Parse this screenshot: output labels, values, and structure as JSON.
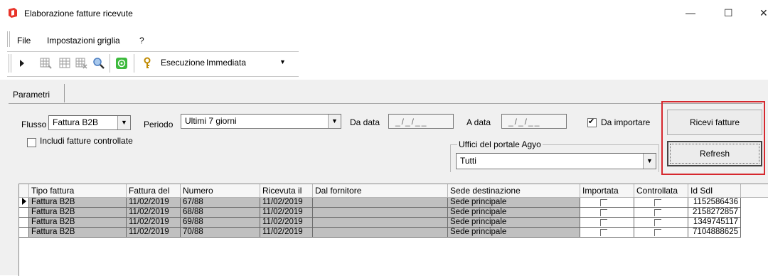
{
  "window": {
    "title": "Elaborazione fatture ricevute",
    "minimize_glyph": "—",
    "maximize_glyph": "☐",
    "close_glyph": "✕"
  },
  "menu": {
    "items": [
      {
        "label": "File"
      },
      {
        "label": "Impostazioni griglia"
      },
      {
        "label": "?"
      }
    ]
  },
  "toolbar": {
    "icons": [
      "play-icon",
      "grid-export-icon",
      "grid-icon",
      "grid-import-icon",
      "magnifier-icon",
      "whatsapp-icon",
      "key-icon"
    ],
    "esecuzione_label": "Esecuzione",
    "esecuzione_value": "Immediata"
  },
  "tabs": [
    {
      "label": "Parametri"
    }
  ],
  "filters": {
    "flusso_label": "Flusso",
    "flusso_value": "Fattura B2B",
    "periodo_label": "Periodo",
    "periodo_value": "Ultimi 7 giorni",
    "da_data_label": "Da data",
    "da_data_value": "_/_/__",
    "a_data_label": "A data",
    "a_data_value": "_/_/__",
    "da_importare_label": "Da importare",
    "da_importare_checked": true,
    "includi_label": "Includi fatture controllate",
    "includi_checked": false,
    "uffici_legend": "Uffici del portale Agyo",
    "uffici_value": "Tutti"
  },
  "buttons": {
    "ricevi": "Ricevi fatture",
    "refresh": "Refresh"
  },
  "colors": {
    "highlight_frame": "#d6282e",
    "row_bg": "#c0c0c0"
  },
  "grid": {
    "columns": [
      "Tipo fattura",
      "Fattura del",
      "Numero",
      "Ricevuta il",
      "Dal fornitore",
      "Sede destinazione",
      "Importata",
      "Controllata",
      "Id SdI"
    ],
    "rows": [
      {
        "tipo": "Fattura B2B",
        "fattura_del": "11/02/2019",
        "numero": "67/88",
        "ricevuta_il": "11/02/2019",
        "fornitore": "",
        "sede": "Sede principale",
        "importata": false,
        "controllata": false,
        "id_sdi": "1152586436"
      },
      {
        "tipo": "Fattura B2B",
        "fattura_del": "11/02/2019",
        "numero": "68/88",
        "ricevuta_il": "11/02/2019",
        "fornitore": "",
        "sede": "Sede principale",
        "importata": false,
        "controllata": false,
        "id_sdi": "2158272857"
      },
      {
        "tipo": "Fattura B2B",
        "fattura_del": "11/02/2019",
        "numero": "69/88",
        "ricevuta_il": "11/02/2019",
        "fornitore": "",
        "sede": "Sede principale",
        "importata": false,
        "controllata": false,
        "id_sdi": "1349745117"
      },
      {
        "tipo": "Fattura B2B",
        "fattura_del": "11/02/2019",
        "numero": "70/88",
        "ricevuta_il": "11/02/2019",
        "fornitore": "",
        "sede": "Sede principale",
        "importata": false,
        "controllata": false,
        "id_sdi": "7104888625"
      }
    ]
  }
}
